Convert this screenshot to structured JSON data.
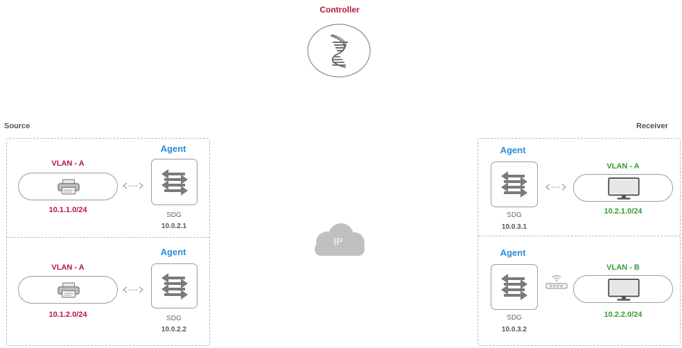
{
  "controller": {
    "label": "Controller",
    "icon": "controller-icon"
  },
  "cloud": {
    "label": "IP",
    "icon": "cloud-icon"
  },
  "source": {
    "title": "Source",
    "nodes": [
      {
        "vlan": "VLAN - A",
        "subnet": "10.1.1.0/24",
        "agent": "Agent",
        "sdg_label": "SDG",
        "sdg_ip": "10.0.2.1",
        "device": "printer-icon"
      },
      {
        "vlan": "VLAN - A",
        "subnet": "10.1.2.0/24",
        "agent": "Agent",
        "sdg_label": "SDG",
        "sdg_ip": "10.0.2.2",
        "device": "printer-icon"
      }
    ]
  },
  "receiver": {
    "title": "Receiver",
    "nodes": [
      {
        "vlan": "VLAN - A",
        "subnet": "10.2.1.0/24",
        "agent": "Agent",
        "sdg_label": "SDG",
        "sdg_ip": "10.0.3.1",
        "device": "monitor-icon",
        "link": "arrow"
      },
      {
        "vlan": "VLAN - B",
        "subnet": "10.2.2.0/24",
        "agent": "Agent",
        "sdg_label": "SDG",
        "sdg_ip": "10.0.3.2",
        "device": "monitor-icon",
        "link": "wifi-router"
      }
    ]
  },
  "colors": {
    "red": "#b5173b",
    "green": "#2f9e2f",
    "blue": "#2a8fd8",
    "border": "#9a9a9a"
  }
}
